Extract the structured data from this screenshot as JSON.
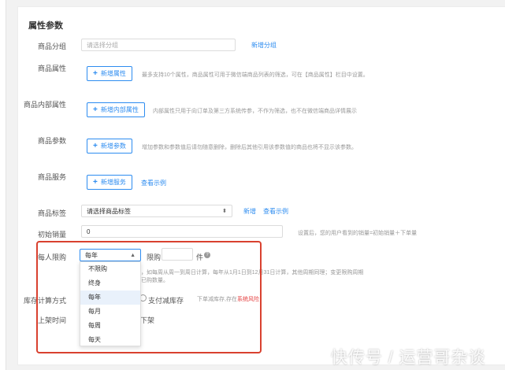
{
  "section": {
    "title": "属性参数"
  },
  "group": {
    "label": "商品分组",
    "placeholder": "请选择分组",
    "add_link": "新增分组"
  },
  "attr": {
    "label": "商品属性",
    "button": "新增属性",
    "hint": "最多支持10个属性，商品属性可用于微信端商品列表的筛选，可在【商品属性】栏目中设置。"
  },
  "internal_attr": {
    "label": "商品内部属性",
    "button": "新增内部属性",
    "hint": "内部属性只用于向订单及第三方系统传参，不作为筛选，也不在微信端商品详情展示"
  },
  "params": {
    "label": "商品参数",
    "button": "新增参数",
    "hint": "增加参数和参数值后请勿随意删除，删除后其他引用该参数值的商品也将不显示该参数。"
  },
  "service": {
    "label": "商品服务",
    "button": "新增服务",
    "example_link": "查看示例"
  },
  "tag": {
    "label": "商品标签",
    "select_value": "请选择商品标签",
    "add_link": "新增",
    "example_link": "查看示例"
  },
  "initial_sales": {
    "label": "初始销量",
    "value": "0",
    "hint": "设置后，您的用户看到的销量=初始销量＋下单量"
  },
  "limit": {
    "label": "每人限购",
    "select_value": "每年",
    "qty_label": "限购",
    "unit": "件",
    "hint_line1": "，如每周从周一到周日计算，每年从1月1日到12月31日计算，其他周期同理；变更限购周期",
    "hint_line2": "已购数量。",
    "options": [
      "不限购",
      "终身",
      "每年",
      "每月",
      "每周",
      "每天"
    ]
  },
  "stock": {
    "label": "库存计算方式",
    "option_pay": "支付减库存",
    "hint_prefix": "下单减库存,存在",
    "hint_red": "系统风险"
  },
  "listing": {
    "label": "上架时间",
    "partial_text": "下架"
  },
  "watermark": "快传号 / 运营哥杂谈",
  "colors": {
    "accent": "#2d8cf0",
    "highlight": "#d9412f",
    "selected_bg": "#e9f1fb"
  }
}
